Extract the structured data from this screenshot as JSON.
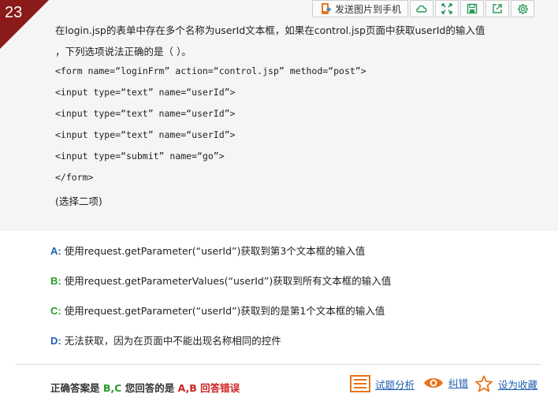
{
  "question": {
    "number": "23",
    "line1": "在login.jsp的表单中存在多个名称为userId文本框，如果在control.jsp页面中获取userId的输入值",
    "line2": "，下列选项说法正确的是（ ）。",
    "code": [
      "<form name=“loginFrm” action=“control.jsp” method=“post”>",
      "<input type=“text” name=“userId”>",
      "<input type=“text” name=“userId”>",
      "<input type=“text” name=“userId”>",
      "<input type=“submit” name=“go”>",
      "</form>"
    ],
    "note": "(选择二项)"
  },
  "toolbar": {
    "send_label": "发送图片到手机",
    "icons": [
      "phone-send-icon",
      "cloud-icon",
      "expand-icon",
      "save-icon",
      "share-icon",
      "gear-icon"
    ]
  },
  "options": [
    {
      "label": "A:",
      "text": "使用request.getParameter(“userId”)获取到第3个文本框的输入值",
      "color": "#1f5fb0"
    },
    {
      "label": "B:",
      "text": "使用request.getParameterValues(“userId”)获取到所有文本框的输入值",
      "color": "#2a9a2a"
    },
    {
      "label": "C:",
      "text": "使用request.getParameter(“userId”)获取到的是第1个文本框的输入值",
      "color": "#2a9a2a"
    },
    {
      "label": "D:",
      "text": "无法获取，因为在页面中不能出现名称相同的控件",
      "color": "#1f5fb0"
    }
  ],
  "answer": {
    "correct_prefix": "正确答案是",
    "correct_value": "B,C",
    "your_prefix": "您回答的是",
    "your_value": "A,B",
    "result": "回答错误"
  },
  "actions": {
    "analysis": "试题分析",
    "report": "纠错",
    "favorite": "设为收藏"
  },
  "colors": {
    "badge": "#8b1a1a",
    "link": "#1f5fb0",
    "correct": "#2a9a2a",
    "wrong": "#cc2222",
    "icon_orange": "#e8731a"
  }
}
